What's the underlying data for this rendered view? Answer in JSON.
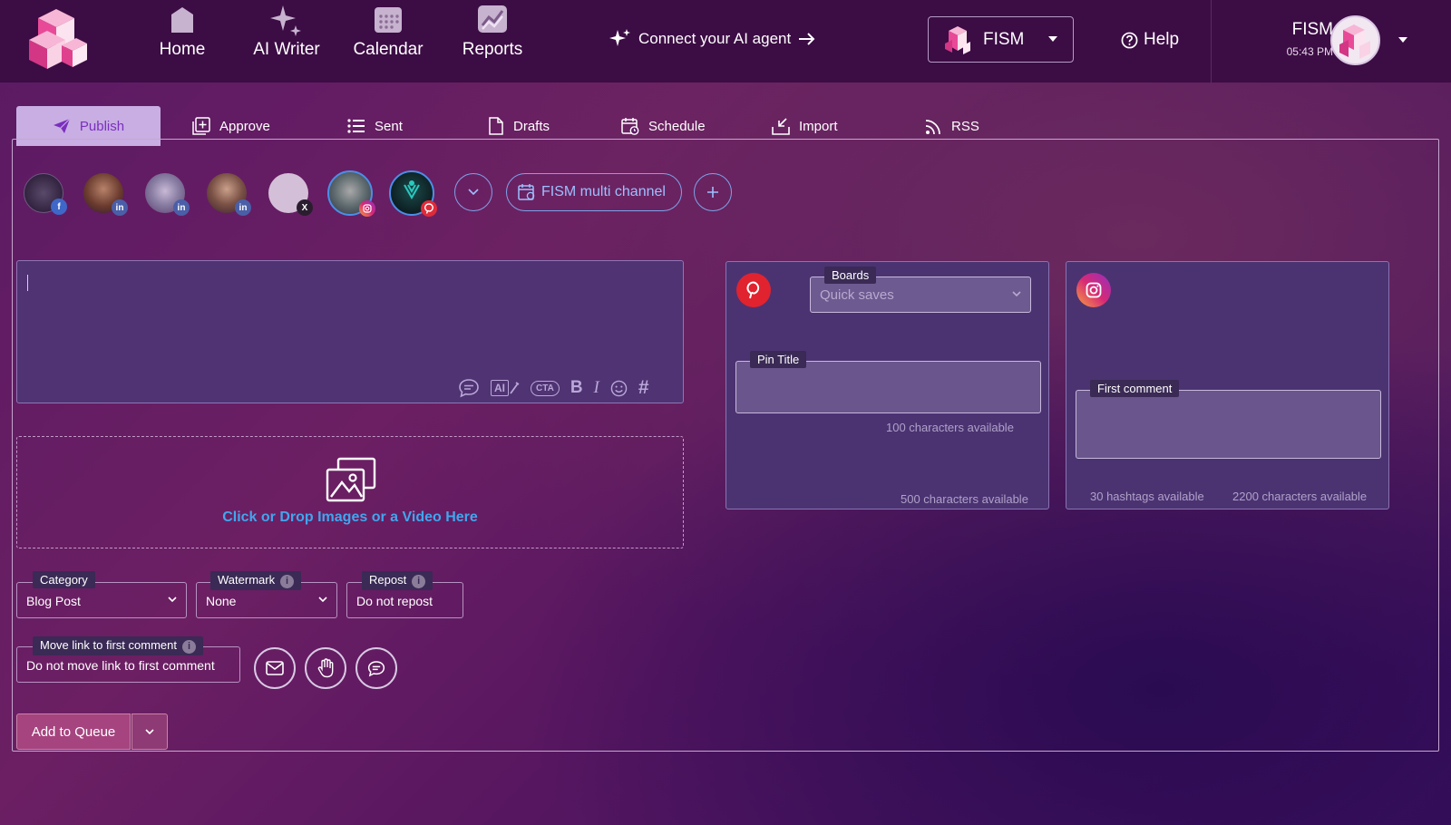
{
  "brand": {
    "accent": "#7a2fbd",
    "link_blue": "#41a6ee",
    "topbar_bg": "#3c0c44"
  },
  "nav": {
    "items": [
      {
        "label": "Home",
        "icon": "home-icon"
      },
      {
        "label": "AI Writer",
        "icon": "sparkle-icon"
      },
      {
        "label": "Calendar",
        "icon": "calendar-icon"
      },
      {
        "label": "Reports",
        "icon": "chart-icon"
      }
    ],
    "connect_label": "Connect your AI agent",
    "account_label": "FISM",
    "help_label": "Help",
    "user_name": "FISM",
    "user_time": "05:43 PM"
  },
  "tabs": [
    {
      "label": "Publish",
      "icon": "send-icon",
      "active": true
    },
    {
      "label": "Approve",
      "icon": "approve-icon"
    },
    {
      "label": "Sent",
      "icon": "list-icon"
    },
    {
      "label": "Drafts",
      "icon": "document-icon"
    },
    {
      "label": "Schedule",
      "icon": "calendar-clock-icon"
    },
    {
      "label": "Import",
      "icon": "import-icon"
    },
    {
      "label": "RSS",
      "icon": "rss-icon"
    }
  ],
  "profiles": [
    {
      "network": "facebook",
      "badge": "f"
    },
    {
      "network": "linkedin",
      "badge": "in"
    },
    {
      "network": "linkedin",
      "badge": "in"
    },
    {
      "network": "linkedin",
      "badge": "in"
    },
    {
      "network": "x",
      "badge": "X"
    },
    {
      "network": "instagram",
      "badge": ""
    },
    {
      "network": "pinterest",
      "badge": ""
    }
  ],
  "multi_channel_label": "FISM multi channel",
  "editor": {
    "toolbar": [
      "comment-icon",
      "ai-icon",
      "cta-icon",
      "B",
      "I",
      "emoji-icon",
      "#"
    ],
    "cta_label": "CTA",
    "ai_label": "AI"
  },
  "dropzone": {
    "text": "Click or Drop Images or a Video Here"
  },
  "fields": {
    "category": {
      "label": "Category",
      "value": "Blog Post"
    },
    "watermark": {
      "label": "Watermark",
      "value": "None"
    },
    "repost": {
      "label": "Repost",
      "value": "Do not repost"
    },
    "move_link": {
      "label": "Move link to first comment",
      "value": "Do not move link to first comment"
    }
  },
  "queue": {
    "label": "Add to Queue"
  },
  "pinterest": {
    "boards_label": "Boards",
    "boards_value": "Quick saves",
    "pin_title_label": "Pin Title",
    "title_avail": "100  characters available",
    "desc_avail": "500 characters available"
  },
  "instagram": {
    "first_comment_label": "First comment",
    "hashtags_avail": "30 hashtags available",
    "chars_avail": "2200 characters available"
  }
}
